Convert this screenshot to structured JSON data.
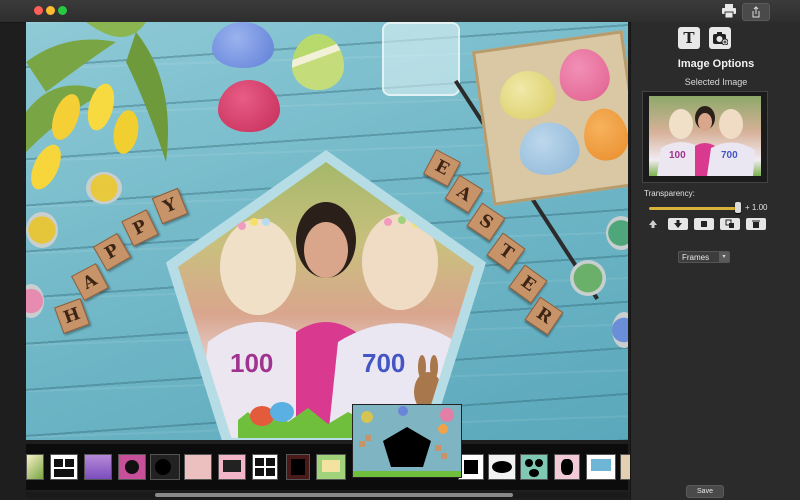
{
  "window": {
    "title_buttons": [
      "close",
      "minimize",
      "maximize"
    ],
    "toolbar_icons": [
      "printer-icon",
      "share-icon"
    ]
  },
  "canvas": {
    "greeting_word_1": [
      "H",
      "A",
      "P",
      "P",
      "Y"
    ],
    "greeting_word_2": [
      "E",
      "A",
      "S",
      "T",
      "E",
      "R"
    ],
    "accent_color": "#c7946a"
  },
  "panel": {
    "tool_text_glyph": "T",
    "title": "Image Options",
    "selected_image_label": "Selected Image",
    "transparency_label": "Transparency:",
    "transparency_value": "+ 1.00",
    "transparency_level": 1.0,
    "arrange_buttons": [
      "move-up",
      "move-down",
      "bring-front",
      "send-back",
      "delete"
    ],
    "category_select": "Frames",
    "save_label": "Save"
  },
  "filmstrip": {
    "thumbnail_count": 21
  }
}
